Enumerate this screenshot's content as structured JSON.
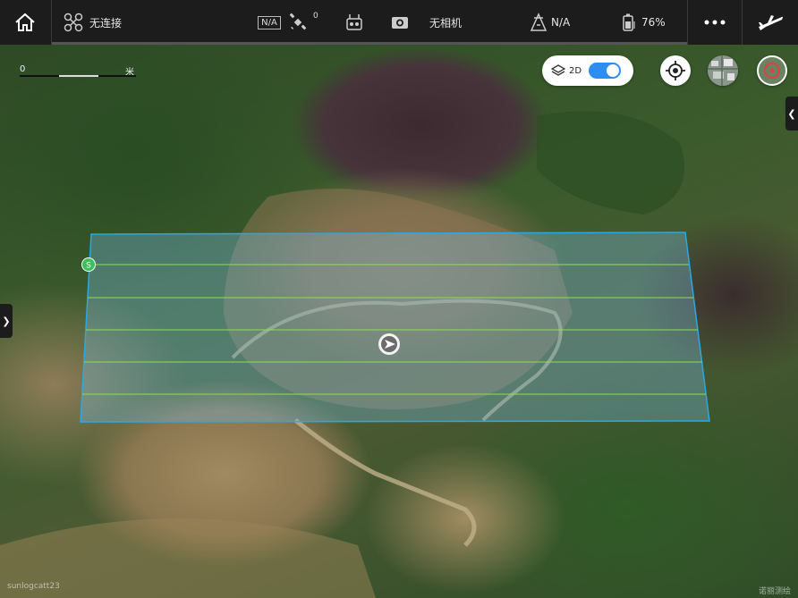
{
  "topbar": {
    "connection_label": "无连接",
    "na_box_label": "N/A",
    "satellite_count": "0",
    "camera_label": "无相机",
    "rtk_value": "N/A",
    "battery_value": "76%"
  },
  "map": {
    "scale_start": "0",
    "scale_end_unit": "米",
    "view_mode_label": "2D",
    "view_toggle_on": true,
    "start_point_label": "S",
    "watermark_left": "sunlogcatt23",
    "watermark_right": "诺丽测绘"
  },
  "colors": {
    "accent": "#2d8df0",
    "survey_border": "#29a8e6",
    "flight_line": "#8ee04a",
    "start_marker": "#3cc15a"
  }
}
